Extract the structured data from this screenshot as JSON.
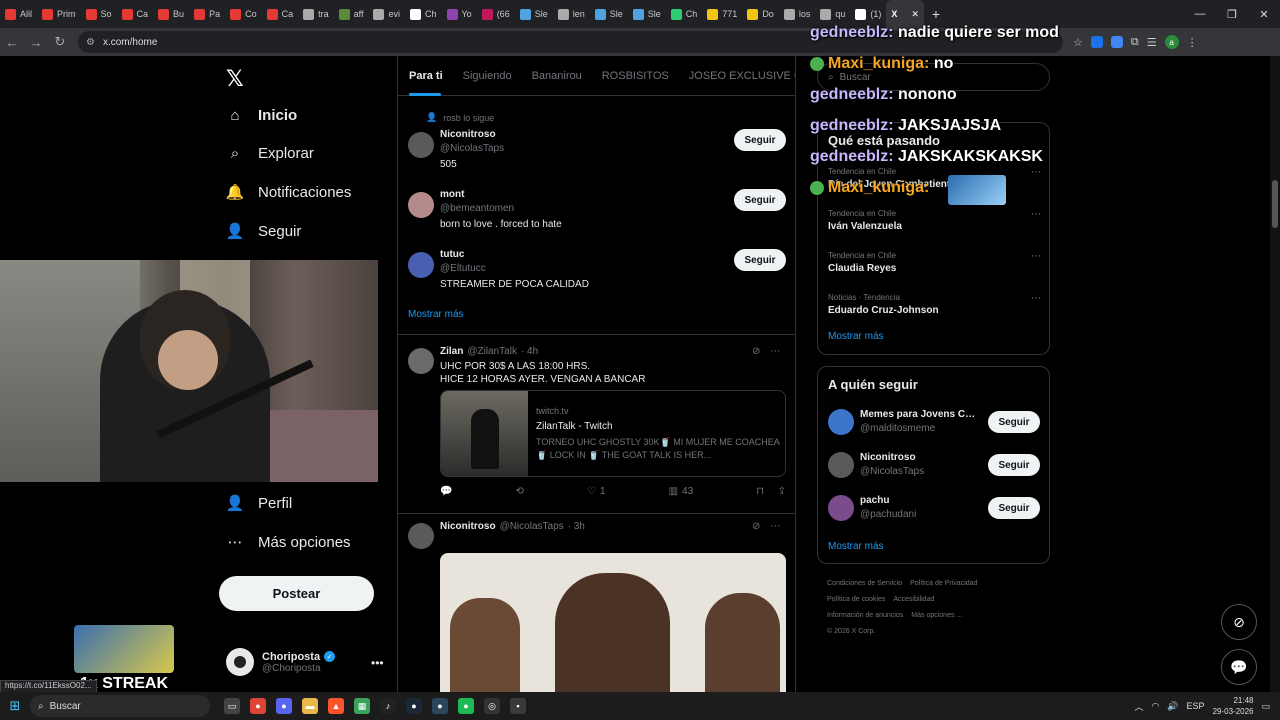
{
  "browser": {
    "tabs": [
      {
        "label": "Alil",
        "color": "#e53935"
      },
      {
        "label": "Prim",
        "color": "#e53935"
      },
      {
        "label": "So",
        "color": "#e53935"
      },
      {
        "label": "Ca",
        "color": "#e53935"
      },
      {
        "label": "Bu",
        "color": "#e53935"
      },
      {
        "label": "Pa",
        "color": "#e53935"
      },
      {
        "label": "Co",
        "color": "#e53935"
      },
      {
        "label": "Ca",
        "color": "#e53935"
      },
      {
        "label": "tra",
        "color": "#aaaaaa"
      },
      {
        "label": "aff",
        "color": "#5c8a3a"
      },
      {
        "label": "evi",
        "color": "#aaaaaa"
      },
      {
        "label": "Ch",
        "color": "#ffffff"
      },
      {
        "label": "Yo",
        "color": "#8e44ad"
      },
      {
        "label": "(66",
        "color": "#c2185b"
      },
      {
        "label": "Sle",
        "color": "#4fa3e0"
      },
      {
        "label": "len",
        "color": "#aaaaaa"
      },
      {
        "label": "Sle",
        "color": "#4fa3e0"
      },
      {
        "label": "Sle",
        "color": "#4fa3e0"
      },
      {
        "label": "Ch",
        "color": "#2ecc71"
      },
      {
        "label": "771",
        "color": "#f1c40f"
      },
      {
        "label": "Do",
        "color": "#f1c40f"
      },
      {
        "label": "los",
        "color": "#aaaaaa"
      },
      {
        "label": "qu",
        "color": "#aaaaaa"
      },
      {
        "label": "(1)",
        "color": "#ffffff"
      }
    ],
    "active_tab": {
      "label": "X"
    },
    "new_tab": "+",
    "url": "x.com/home",
    "status_url": "https://t.co/11EkssO02..."
  },
  "nav": {
    "logo": "𝕏",
    "items": [
      {
        "label": "Inicio",
        "icon": "home-icon",
        "glyph": "⌂",
        "bold": true
      },
      {
        "label": "Explorar",
        "icon": "search-icon",
        "glyph": "⌕"
      },
      {
        "label": "Notificaciones",
        "icon": "bell-icon",
        "glyph": "🔔"
      },
      {
        "label": "Seguir",
        "icon": "add-user-icon",
        "glyph": "👤"
      },
      {
        "label": "Perfil",
        "icon": "profile-icon",
        "glyph": "👤"
      },
      {
        "label": "Más opciones",
        "icon": "more-options-icon",
        "glyph": "⋯"
      }
    ],
    "post_button": "Postear",
    "account": {
      "name": "Choriposta",
      "handle": "@Choriposta"
    }
  },
  "overlay": {
    "streak": "1x STREAK"
  },
  "main": {
    "tabs": [
      "Para ti",
      "Siguiendo",
      "Bananirou",
      "ROSBISITOS",
      "JOSEO EXCLUSIVE CLUB"
    ],
    "followed_by": "rosb lo sigue",
    "suggestions": [
      {
        "name": "Niconitroso",
        "handle": "@NicolasTaps",
        "bio": "505",
        "follow": "Seguir",
        "avatar_color": "#5a5a5a"
      },
      {
        "name": "mont",
        "handle": "@bemeantomen",
        "bio": "born to love . forced to hate",
        "follow": "Seguir",
        "avatar_color": "#b48a8a"
      },
      {
        "name": "tutuc",
        "handle": "@Eltutucc",
        "bio": "STREAMER DE POCA CALIDAD",
        "follow": "Seguir",
        "avatar_color": "#4a5fb0"
      }
    ],
    "show_more": "Mostrar más",
    "post1": {
      "name": "Zilan",
      "handle": "@ZilanTalk",
      "time": "· 4h",
      "text_line1": "UHC POR 30$ A LAS 18:00 HRS.",
      "text_line2": "HICE 12 HORAS AYER. VENGAN A BANCAR",
      "card": {
        "domain": "twitch.tv",
        "title": "ZilanTalk - Twitch",
        "desc": "TORNEO UHC GHOSTLY 30K🥤 MI MUJER ME COACHEA 🥤 LOCK IN 🥤 THE GOAT TALK IS HER..."
      },
      "actions": {
        "replies": "",
        "reposts": "",
        "likes": "1",
        "views": "43"
      }
    },
    "post2": {
      "name": "Niconitroso",
      "handle": "@NicolasTaps",
      "time": "· 3h"
    }
  },
  "right": {
    "search_placeholder": "Buscar",
    "trending_title": "Qué está pasando",
    "trends": [
      {
        "context": "Tendencia en Chile",
        "topic": "Día del Joven Combatiente"
      },
      {
        "context": "Tendencia en Chile",
        "topic": "Iván Valenzuela"
      },
      {
        "context": "Tendencia en Chile",
        "topic": "Claudia Reyes"
      },
      {
        "context": "Noticias · Tendencia",
        "topic": "Eduardo Cruz-Johnson"
      }
    ],
    "show_more": "Mostrar más",
    "who_title": "A quién seguir",
    "who": [
      {
        "name": "Memes para Jovens CL...",
        "handle": "@malditosmeme",
        "follow": "Seguir",
        "avatar_color": "#3b74c9"
      },
      {
        "name": "Niconitroso",
        "handle": "@NicolasTaps",
        "follow": "Seguir",
        "avatar_color": "#5a5a5a"
      },
      {
        "name": "pachu",
        "handle": "@pachudani",
        "follow": "Seguir",
        "avatar_color": "#7a4c8c"
      }
    ],
    "who_more": "Mostrar más",
    "footer": [
      "Condiciones de Servicio",
      "Política de Privacidad",
      "Política de cookies",
      "Accesibilidad",
      "Información de anuncios",
      "Más opciones ...",
      "© 2026 X Corp."
    ]
  },
  "chat": [
    {
      "user": "gedneeblz",
      "msg": "nadie quiere ser mod",
      "emote": false
    },
    {
      "user": "Maxi_kuniga",
      "msg": "no",
      "emote": true
    },
    {
      "user": "gedneeblz",
      "msg": "nonono",
      "emote": false
    },
    {
      "user": "gedneeblz",
      "msg": "JAKSJAJSJA",
      "emote": false
    },
    {
      "user": "gedneeblz",
      "msg": "JAKSKAKSKAKSK",
      "emote": false
    },
    {
      "user": "Maxi_kuniga",
      "msg": "",
      "emote": true
    }
  ],
  "taskbar": {
    "search": "Buscar",
    "lang": "ESP",
    "time": "21:48",
    "date": "29-03-2026"
  }
}
